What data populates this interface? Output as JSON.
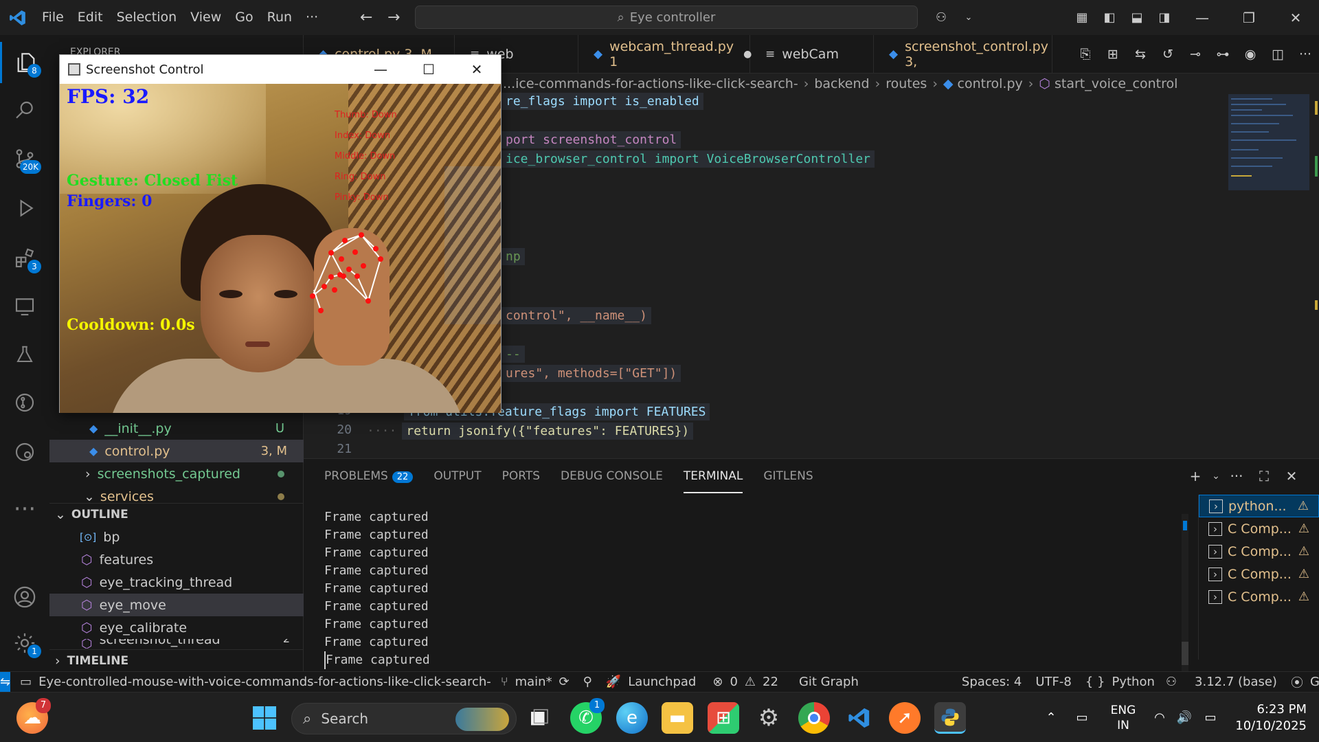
{
  "titlebar": {
    "menus": [
      "File",
      "Edit",
      "Selection",
      "View",
      "Go",
      "Run",
      "···"
    ],
    "command_center": "Eye controller"
  },
  "activity_bar": {
    "badges": {
      "explorer": "8",
      "source_control": "20K",
      "extensions": "3",
      "settings": "1"
    }
  },
  "sidebar": {
    "explorer_header": "EXPLORER",
    "files": [
      {
        "name": "__init__.py",
        "status": "U"
      },
      {
        "name": "control.py",
        "status": "3, M"
      },
      {
        "name": "screenshots_captured",
        "status": ""
      },
      {
        "name": "services",
        "status": ""
      }
    ],
    "outline_header": "OUTLINE",
    "outline_items": [
      "bp",
      "features",
      "eye_tracking_thread",
      "eye_move",
      "eye_calibrate",
      "screenshot_thread"
    ],
    "outline_tail_count": "2",
    "timeline_header": "TIMELINE"
  },
  "tabs": [
    {
      "label": "control.py 3, M"
    },
    {
      "label": "web"
    },
    {
      "label": "webcam_thread.py 1"
    },
    {
      "label": "webCam"
    },
    {
      "label": "screenshot_control.py 3,"
    }
  ],
  "breadcrumb": [
    "...ice-commands-for-actions-like-click-search-",
    "backend",
    "routes",
    "control.py",
    "start_voice_control"
  ],
  "code": {
    "l1": "re_flags import is_enabled",
    "l2": "port screenshot_control",
    "l3": "ice_browser_control import VoiceBrowserController",
    "l4": "np",
    "l5": "control\", __name__)",
    "l6": "--",
    "l7": "ures\", methods=[\"GET\"])",
    "l8": "from utils.feature_flags import FEATURES",
    "l9": "return jsonify({\"features\": FEATURES})",
    "line_numbers": [
      "19",
      "20",
      "21"
    ]
  },
  "panel": {
    "tabs": [
      "PROBLEMS",
      "OUTPUT",
      "PORTS",
      "DEBUG CONSOLE",
      "TERMINAL",
      "GITLENS"
    ],
    "problems_count": "22",
    "terminal_lines": [
      "Frame captured",
      "Frame captured",
      "Frame captured",
      "Frame captured",
      "Frame captured",
      "Frame captured",
      "Frame captured",
      "Frame captured",
      "Frame captured"
    ],
    "terminals": [
      "python...",
      "C Comp...",
      "C Comp...",
      "C Comp...",
      "C Comp..."
    ]
  },
  "statusbar": {
    "folder": "Eye-controlled-mouse-with-voice-commands-for-actions-like-click-search-",
    "branch": "main*",
    "launchpad": "Launchpad",
    "errors": "0",
    "warnings": "22",
    "git_graph": "Git Graph",
    "spaces": "Spaces: 4",
    "encoding": "UTF-8",
    "language": "Python",
    "interpreter": "3.12.7 (base)",
    "go_live": "Go Live"
  },
  "camwin": {
    "title": "Screenshot Control",
    "fps": "FPS: 32",
    "gesture": "Gesture: Closed Fist",
    "fingers": "Fingers: 0",
    "cooldown": "Cooldown: 0.0s",
    "finger_states": [
      "Thumb: Down",
      "Index: Down",
      "Middle: Down",
      "Ring: Down",
      "Pinky: Down"
    ]
  },
  "taskbar": {
    "search_placeholder": "Search",
    "weather_badge": "7",
    "whatsapp_badge": "1",
    "lang_top": "ENG",
    "lang_bottom": "IN",
    "time": "6:23 PM",
    "date": "10/10/2025"
  },
  "colors": {
    "accent": "#0078d4",
    "warning": "#e2c08d",
    "fps_blue": "#1a1aff",
    "gesture_green": "#22dd22",
    "cooldown_yellow": "#f5f500"
  }
}
